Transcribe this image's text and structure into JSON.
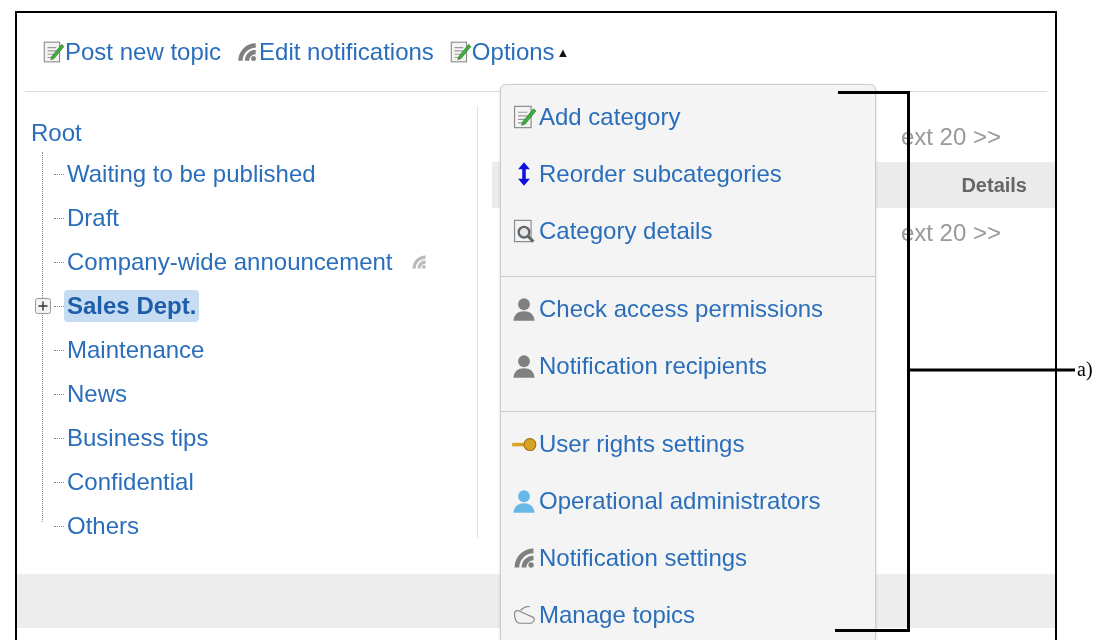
{
  "toolbar": [
    {
      "label": "Post new topic",
      "kind": "note"
    },
    {
      "label": "Edit notifications",
      "kind": "signal"
    },
    {
      "label": "Options",
      "kind": "note",
      "caret": "▲"
    }
  ],
  "tree": {
    "root": "Root",
    "children": [
      {
        "label": "Waiting to be published",
        "selected": false,
        "expandable": false,
        "notify": false
      },
      {
        "label": "Draft",
        "selected": false,
        "expandable": false,
        "notify": false
      },
      {
        "label": "Company-wide announcement",
        "selected": false,
        "expandable": false,
        "notify": true
      },
      {
        "label": "Sales Dept.",
        "selected": true,
        "expandable": true,
        "notify": false
      },
      {
        "label": "Maintenance",
        "selected": false,
        "expandable": false,
        "notify": false
      },
      {
        "label": "News",
        "selected": false,
        "expandable": false,
        "notify": false
      },
      {
        "label": "Business tips",
        "selected": false,
        "expandable": false,
        "notify": false
      },
      {
        "label": "Confidential",
        "selected": false,
        "expandable": false,
        "notify": false
      },
      {
        "label": "Others",
        "selected": false,
        "expandable": false,
        "notify": false
      }
    ]
  },
  "list": {
    "pager_top": "ext 20 >>",
    "columns": [
      "Details"
    ],
    "pager_bottom": "ext 20 >>"
  },
  "options_menu": [
    [
      {
        "label": "Add category",
        "kind": "note"
      },
      {
        "label": "Reorder subcategories",
        "kind": "updown"
      },
      {
        "label": "Category details",
        "kind": "docsearch"
      }
    ],
    [
      {
        "label": "Check access permissions",
        "kind": "person"
      },
      {
        "label": "Notification recipients",
        "kind": "person"
      }
    ],
    [
      {
        "label": "User rights settings",
        "kind": "key"
      },
      {
        "label": "Operational administrators",
        "kind": "admin"
      },
      {
        "label": "Notification settings",
        "kind": "signal"
      },
      {
        "label": "Manage topics",
        "kind": "shoe"
      }
    ]
  ],
  "callout": {
    "label": "a)"
  }
}
